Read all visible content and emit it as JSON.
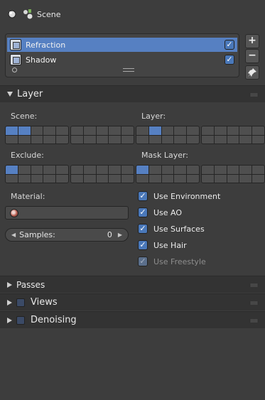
{
  "header": {
    "context_icon": "render-layers-icon",
    "scene_icon": "scene-icon",
    "title": "Scene"
  },
  "layers_list": {
    "items": [
      {
        "label": "Refraction",
        "selected": true,
        "enabled": true
      },
      {
        "label": "Shadow",
        "selected": false,
        "enabled": true
      }
    ],
    "buttons": {
      "add": "+",
      "remove": "−",
      "pin": "pin-icon"
    }
  },
  "layer_panel": {
    "title": "Layer",
    "scene_label": "Scene:",
    "layer_label": "Layer:",
    "exclude_label": "Exclude:",
    "mask_label": "Mask Layer:",
    "material_label": "Material:",
    "material_value": "",
    "samples_label": "Samples:",
    "samples_value": "0",
    "toggles": [
      {
        "label": "Use Environment",
        "checked": true,
        "enabled": true
      },
      {
        "label": "Use AO",
        "checked": true,
        "enabled": true
      },
      {
        "label": "Use Surfaces",
        "checked": true,
        "enabled": true
      },
      {
        "label": "Use Hair",
        "checked": true,
        "enabled": true
      },
      {
        "label": "Use Freestyle",
        "checked": true,
        "enabled": false
      }
    ],
    "scene_layers_active": [
      0,
      1
    ],
    "view_layers_active": [
      1
    ],
    "exclude_layers_active": [
      0
    ],
    "mask_layers_active": [
      0
    ]
  },
  "panels": [
    {
      "title": "Passes",
      "has_checkbox": false
    },
    {
      "title": "Views",
      "has_checkbox": true
    },
    {
      "title": "Denoising",
      "has_checkbox": true
    }
  ],
  "colors": {
    "accent": "#5680c2",
    "background": "#3d3d3d",
    "panel_header": "#333333"
  }
}
